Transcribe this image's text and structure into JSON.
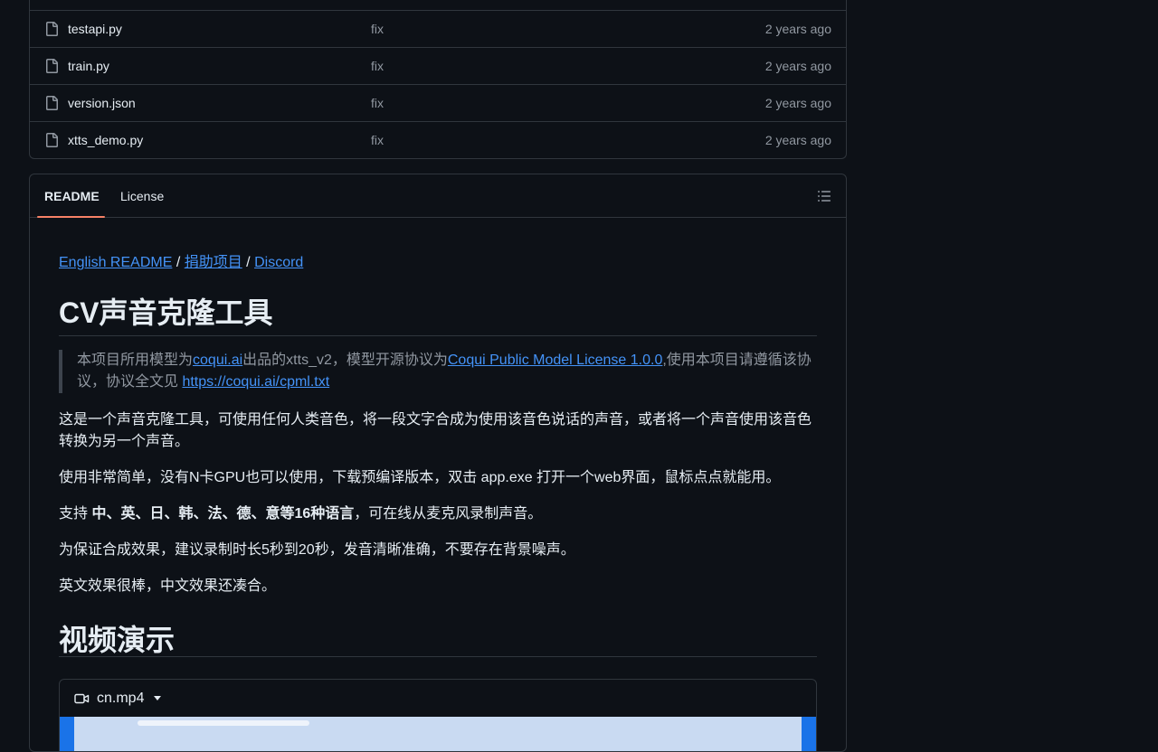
{
  "files": [
    {
      "name": "testapi.py",
      "message": "fix",
      "date": "2 years ago"
    },
    {
      "name": "train.py",
      "message": "fix",
      "date": "2 years ago"
    },
    {
      "name": "version.json",
      "message": "fix",
      "date": "2 years ago"
    },
    {
      "name": "xtts_demo.py",
      "message": "fix",
      "date": "2 years ago"
    }
  ],
  "readme": {
    "tabs": {
      "readme": "README",
      "license": "License"
    },
    "links": {
      "english": "English README",
      "sep": " / ",
      "donate": "捐助项目",
      "discord": "Discord"
    },
    "title": "CV声音克隆工具",
    "quote": {
      "p1": "本项目所用模型为",
      "l1": "coqui.ai",
      "p2": "出品的xtts_v2，模型开源协议为",
      "l2": "Coqui Public Model License 1.0.0",
      "p3": ",使用本项目请遵循该协议，协议全文见 ",
      "l3": "https://coqui.ai/cpml.txt"
    },
    "para1": "这是一个声音克隆工具，可使用任何人类音色，将一段文字合成为使用该音色说话的声音，或者将一个声音使用该音色转换为另一个声音。",
    "para2": "使用非常简单，没有N卡GPU也可以使用，下载预编译版本，双击 app.exe 打开一个web界面，鼠标点点就能用。",
    "para3": {
      "pre": "支持 ",
      "bold": "中、英、日、韩、法、德、意等16种语言",
      "post": "，可在线从麦克风录制声音。"
    },
    "para4": "为保证合成效果，建议录制时长5秒到20秒，发音清晰准确，不要存在背景噪声。",
    "para5": "英文效果很棒，中文效果还凑合。",
    "heading2": "视频演示",
    "video": {
      "filename": "cn.mp4"
    }
  },
  "colors": {
    "background": "#0d1117",
    "border": "#30363d",
    "link": "#4493f8",
    "muted": "#9198a1",
    "tab_accent": "#f78166"
  },
  "icons": {
    "file": "file-icon",
    "outline": "list-unordered-icon",
    "video": "video-icon"
  }
}
